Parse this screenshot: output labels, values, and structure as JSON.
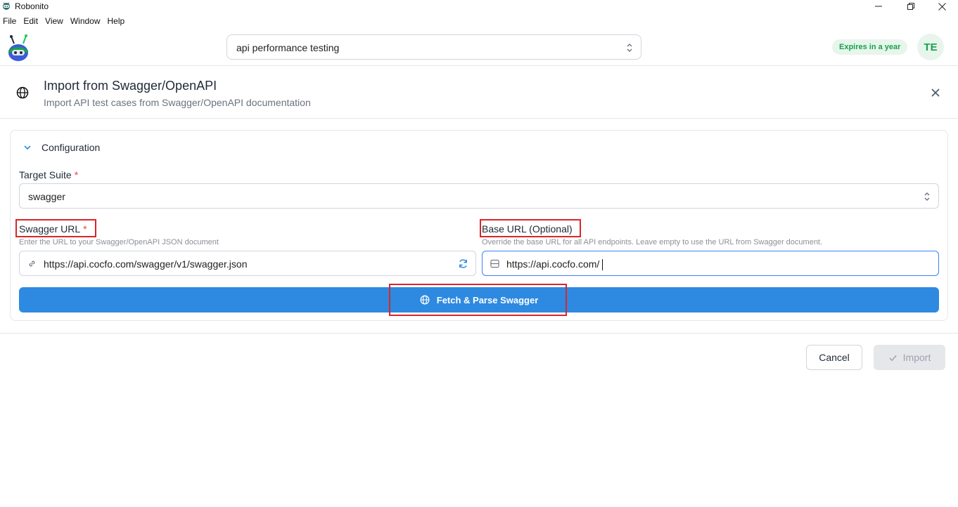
{
  "window": {
    "title": "Robonito",
    "controls": {
      "minimize": "minimize-icon",
      "maximize": "restore-icon",
      "close": "close-icon"
    }
  },
  "menu": [
    "File",
    "Edit",
    "View",
    "Window",
    "Help"
  ],
  "header": {
    "project": "api performance testing",
    "license_badge": "Expires in a year",
    "avatar_initials": "TE"
  },
  "dialog": {
    "title": "Import from Swagger/OpenAPI",
    "subtitle": "Import API test cases from Swagger/OpenAPI documentation",
    "section_title": "Configuration",
    "target_suite": {
      "label": "Target Suite",
      "required": "*",
      "value": "swagger"
    },
    "swagger_url": {
      "label": "Swagger URL",
      "required": "*",
      "help": "Enter the URL to your Swagger/OpenAPI JSON document",
      "value": "https://api.cocfo.com/swagger/v1/swagger.json"
    },
    "base_url": {
      "label": "Base URL (Optional)",
      "help": "Override the base URL for all API endpoints. Leave empty to use the URL from Swagger document.",
      "value": "https://api.cocfo.com/"
    },
    "fetch_button": "Fetch & Parse Swagger",
    "cancel_button": "Cancel",
    "import_button": "Import"
  },
  "colors": {
    "primary": "#2d8ae0",
    "highlight": "#d9252b",
    "badge_green": "#16a34a",
    "required": "#ef4444"
  }
}
